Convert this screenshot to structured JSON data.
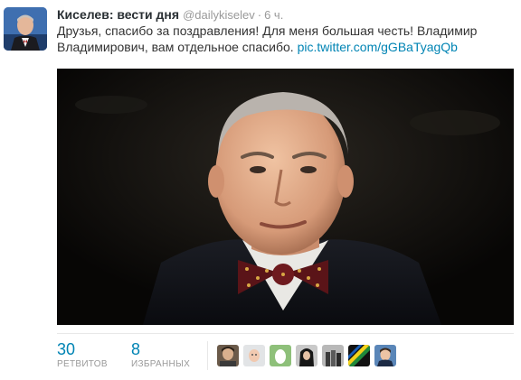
{
  "tweet": {
    "fullname": "Киселев: вести дня",
    "screen_name": "@dailykiselev",
    "separator": "·",
    "time": "6 ч.",
    "text": "Друзья, спасибо за поздравления! Для меня большая честь! Владимир Владимирович, вам отдельное спасибо.",
    "link": "pic.twitter.com/gGBaTyagQb"
  },
  "stats": {
    "retweets_count": "30",
    "retweets_label": "РЕТВИТОВ",
    "favorites_count": "8",
    "favorites_label": "ИЗБРАННЫХ"
  },
  "favoriters": [
    {
      "name": "favoriter-avatar-1-icon"
    },
    {
      "name": "favoriter-avatar-2-icon"
    },
    {
      "name": "favoriter-avatar-3-icon"
    },
    {
      "name": "favoriter-avatar-4-icon"
    },
    {
      "name": "favoriter-avatar-5-icon"
    },
    {
      "name": "favoriter-avatar-6-icon"
    },
    {
      "name": "favoriter-avatar-7-icon"
    }
  ],
  "colors": {
    "link": "#0084b4",
    "muted": "#999999",
    "name": "#292f33"
  }
}
